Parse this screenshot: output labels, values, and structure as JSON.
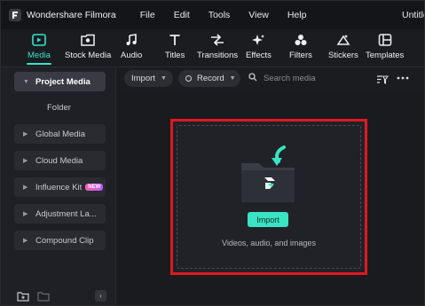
{
  "app": {
    "name": "Wondershare Filmora",
    "document_title": "Untitle",
    "accent_color": "#34e3c9",
    "highlight_color": "#e01820"
  },
  "menu": [
    "File",
    "Edit",
    "Tools",
    "View",
    "Help"
  ],
  "toolbar": {
    "tabs": [
      {
        "label": "Media",
        "icon": "media-icon",
        "active": true
      },
      {
        "label": "Stock Media",
        "icon": "stock-media-icon",
        "active": false
      },
      {
        "label": "Audio",
        "icon": "music-note-icon",
        "active": false
      },
      {
        "label": "Titles",
        "icon": "text-t-icon",
        "active": false
      },
      {
        "label": "Transitions",
        "icon": "transitions-icon",
        "active": false
      },
      {
        "label": "Effects",
        "icon": "effects-sparkle-icon",
        "active": false
      },
      {
        "label": "Filters",
        "icon": "filters-icon",
        "active": false
      },
      {
        "label": "Stickers",
        "icon": "stickers-icon",
        "active": false
      },
      {
        "label": "Templates",
        "icon": "templates-icon",
        "active": false
      }
    ]
  },
  "sidebar": {
    "project_media": "Project Media",
    "folder": "Folder",
    "items": [
      {
        "label": "Global Media"
      },
      {
        "label": "Cloud Media"
      },
      {
        "label": "Influence Kit",
        "badge": "NEW"
      },
      {
        "label": "Adjustment La..."
      },
      {
        "label": "Compound Clip"
      }
    ]
  },
  "media_bar": {
    "import_label": "Import",
    "record_label": "Record",
    "search_placeholder": "Search media"
  },
  "content": {
    "import_button": "Import",
    "hint": "Videos, audio, and images"
  }
}
